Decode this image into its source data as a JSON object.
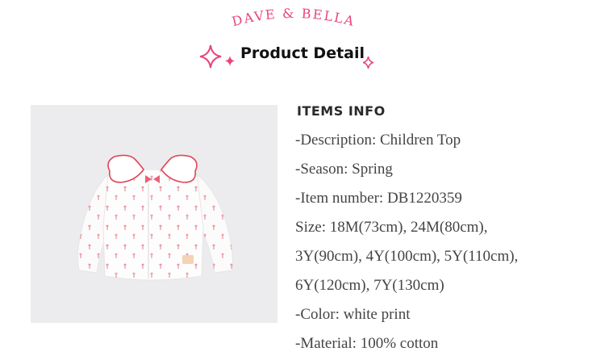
{
  "header": {
    "brand": "DAVE & BELLA",
    "title": "Product Detail"
  },
  "product_image": {
    "alt": "Children Top"
  },
  "info": {
    "heading": "ITEMS INFO",
    "lines": [
      "-Description: Children Top",
      "-Season: Spring",
      "-Item number: DB1220359",
      "Size:  18M(73cm), 24M(80cm),",
      "3Y(90cm), 4Y(100cm), 5Y(110cm),",
      "6Y(120cm), 7Y(130cm)",
      "-Color: white print",
      "-Material: 100% cotton"
    ]
  },
  "colors": {
    "brand_pink": "#e8457a",
    "text": "#444444",
    "heading": "#2a2a2a"
  }
}
